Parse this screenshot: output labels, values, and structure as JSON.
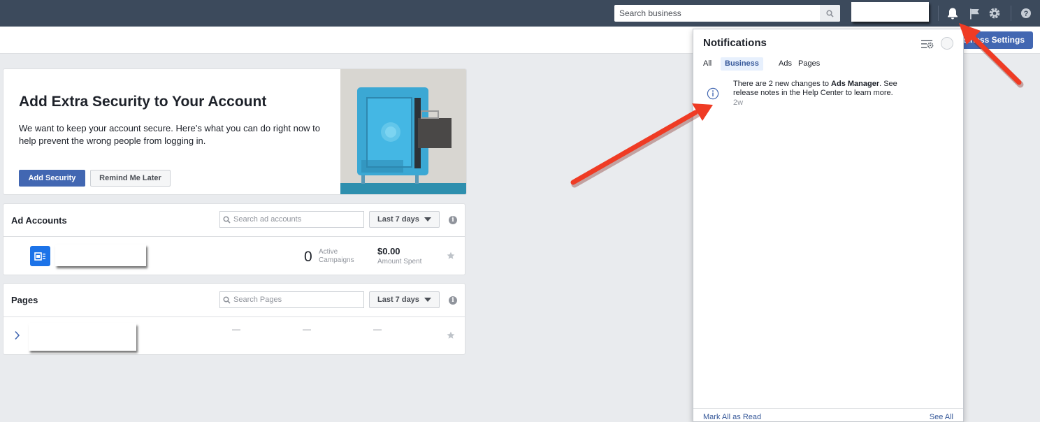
{
  "topbar": {
    "search_placeholder": "Search business"
  },
  "subbar": {
    "business_settings_label": "Business Settings",
    "visible_label_part": "isiness Settings"
  },
  "security_card": {
    "title": "Add Extra Security to Your Account",
    "text": "We want to keep your account secure. Here’s what you can do right now to help prevent the wrong people from logging in.",
    "primary_button": "Add Security",
    "secondary_button": "Remind Me Later"
  },
  "ad_accounts": {
    "title": "Ad Accounts",
    "search_placeholder": "Search ad accounts",
    "range_label": "Last 7 days",
    "row": {
      "active_count": "0",
      "active_label_1": "Active",
      "active_label_2": "Campaigns",
      "amount": "$0.00",
      "amount_label": "Amount Spent"
    }
  },
  "pages": {
    "title": "Pages",
    "search_placeholder": "Search Pages",
    "range_label": "Last 7 days",
    "row": {
      "col1": "—",
      "col2": "—",
      "col3": "—"
    }
  },
  "notifications": {
    "title": "Notifications",
    "tabs": [
      {
        "label": "All",
        "active": false
      },
      {
        "label": "Business",
        "active": true
      },
      {
        "label": "Ads",
        "active": false
      },
      {
        "label": "Pages",
        "active": false
      }
    ],
    "item": {
      "text_prefix": "There are 2 new changes to ",
      "text_bold": "Ads Manager",
      "text_suffix": ". See release notes in the Help Center to learn more.",
      "time": "2w"
    },
    "mark_all_read": "Mark All as Read",
    "see_all": "See All"
  },
  "icons": {
    "bell": "bell-icon",
    "flag": "flag-icon",
    "gear": "gear-icon",
    "help": "help-icon",
    "search": "search-icon",
    "info": "info-icon",
    "star": "star-icon",
    "chevron": "chevron-right-icon",
    "notif_settings": "notification-settings-icon"
  },
  "colors": {
    "topbar": "#3c4a5c",
    "accent": "#4267b2",
    "link": "#365899",
    "annotation_arrow": "#ef3b24"
  }
}
